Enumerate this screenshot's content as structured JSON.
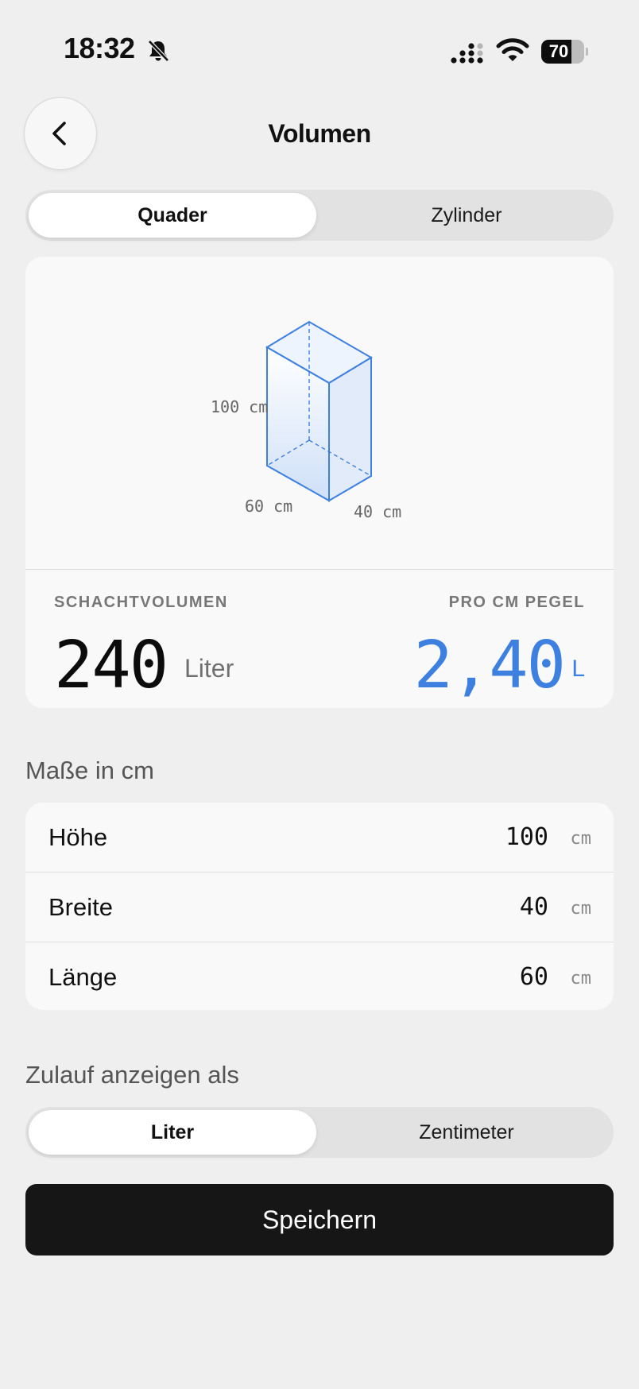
{
  "status_bar": {
    "time": "18:32",
    "battery": "70",
    "battery_level": 0.7,
    "icons": [
      "bell-slash-icon",
      "signal-icon",
      "wifi-icon",
      "battery-icon"
    ]
  },
  "header": {
    "title": "Volumen",
    "back_icon": "chevron-left-icon"
  },
  "shape_tabs": {
    "options": [
      "Quader",
      "Zylinder"
    ],
    "selected": "Quader"
  },
  "visual": {
    "height_label": "100 cm",
    "length_label": "60 cm",
    "width_label": "40 cm",
    "accent_color": "#3d80e0"
  },
  "stats": {
    "volume_label": "SCHACHTVOLUMEN",
    "volume_value": "240",
    "volume_unit": "Liter",
    "per_cm_label": "PRO CM PEGEL",
    "per_cm_value": "2,40",
    "per_cm_unit": "L"
  },
  "dimensions": {
    "section_title": "Maße in cm",
    "rows": [
      {
        "label": "Höhe",
        "value": "100",
        "unit": "cm"
      },
      {
        "label": "Breite",
        "value": "40",
        "unit": "cm"
      },
      {
        "label": "Länge",
        "value": "60",
        "unit": "cm"
      }
    ]
  },
  "inflow": {
    "section_title": "Zulauf anzeigen als",
    "options": [
      "Liter",
      "Zentimeter"
    ],
    "selected": "Liter"
  },
  "save_label": "Speichern"
}
